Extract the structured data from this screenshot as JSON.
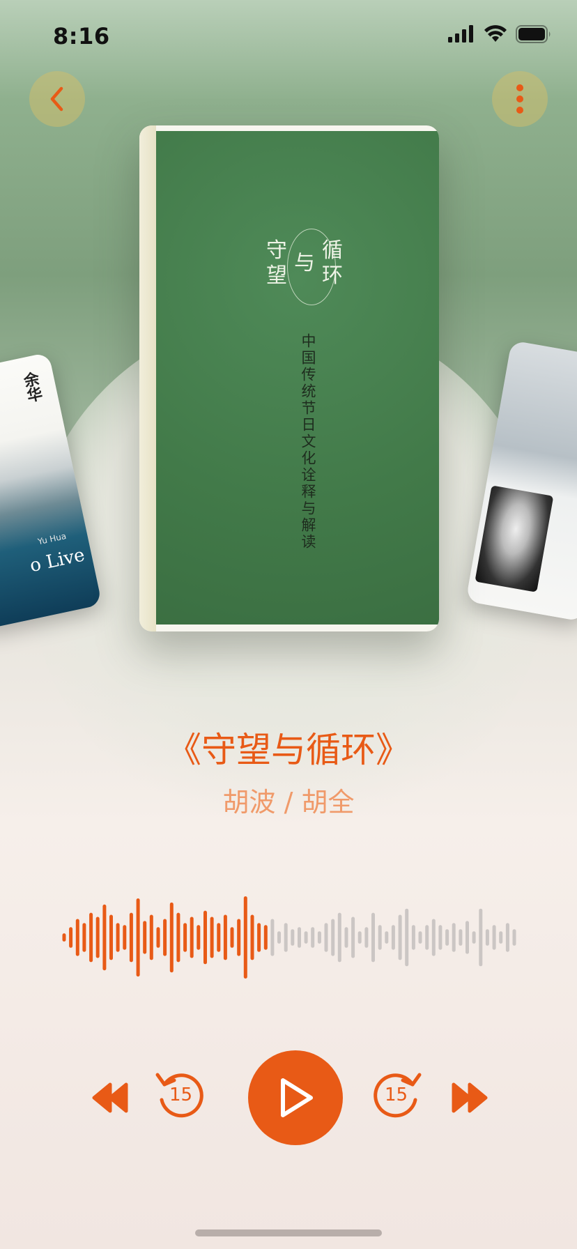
{
  "status_bar": {
    "time": "8:16",
    "icons": [
      "cellular-signal-icon",
      "wifi-icon",
      "battery-icon"
    ]
  },
  "header": {
    "back_icon": "chevron-left-icon",
    "more_icon": "more-vertical-icon"
  },
  "carousel": {
    "current": {
      "cover_title_chars": [
        "守",
        "望",
        "与",
        "循",
        "环"
      ],
      "cover_subtitle": "中国传统节日文化诠释与解读"
    },
    "previous": {
      "author": "余华",
      "title_fragment": "o Live",
      "author_latin": "Yu Hua"
    },
    "next": {}
  },
  "book": {
    "title": "《守望与循环》",
    "author": "胡波 / 胡全"
  },
  "player": {
    "progress": 0.45,
    "waveform_levels": [
      0.1,
      0.25,
      0.45,
      0.35,
      0.6,
      0.5,
      0.8,
      0.55,
      0.35,
      0.3,
      0.6,
      0.95,
      0.4,
      0.55,
      0.25,
      0.45,
      0.85,
      0.6,
      0.35,
      0.5,
      0.3,
      0.65,
      0.5,
      0.35,
      0.55,
      0.25,
      0.45,
      1.0,
      0.55,
      0.35,
      0.3,
      0.45,
      0.15,
      0.35,
      0.2,
      0.25,
      0.15,
      0.25,
      0.15,
      0.35,
      0.45,
      0.6,
      0.25,
      0.5,
      0.15,
      0.25,
      0.6,
      0.3,
      0.15,
      0.3,
      0.55,
      0.7,
      0.3,
      0.15,
      0.3,
      0.45,
      0.3,
      0.2,
      0.35,
      0.2,
      0.4,
      0.15,
      0.7,
      0.2,
      0.3,
      0.15,
      0.35,
      0.2
    ],
    "colors": {
      "accent": "#e85a16",
      "inactive": "#cbc6c4"
    },
    "controls": {
      "rewind_icon": "rewind-icon",
      "skip_back_icon": "skip-back-15-icon",
      "skip_back_label": "15",
      "play_icon": "play-icon",
      "skip_forward_icon": "skip-forward-15-icon",
      "skip_forward_label": "15",
      "fast_forward_icon": "fast-forward-icon"
    }
  }
}
